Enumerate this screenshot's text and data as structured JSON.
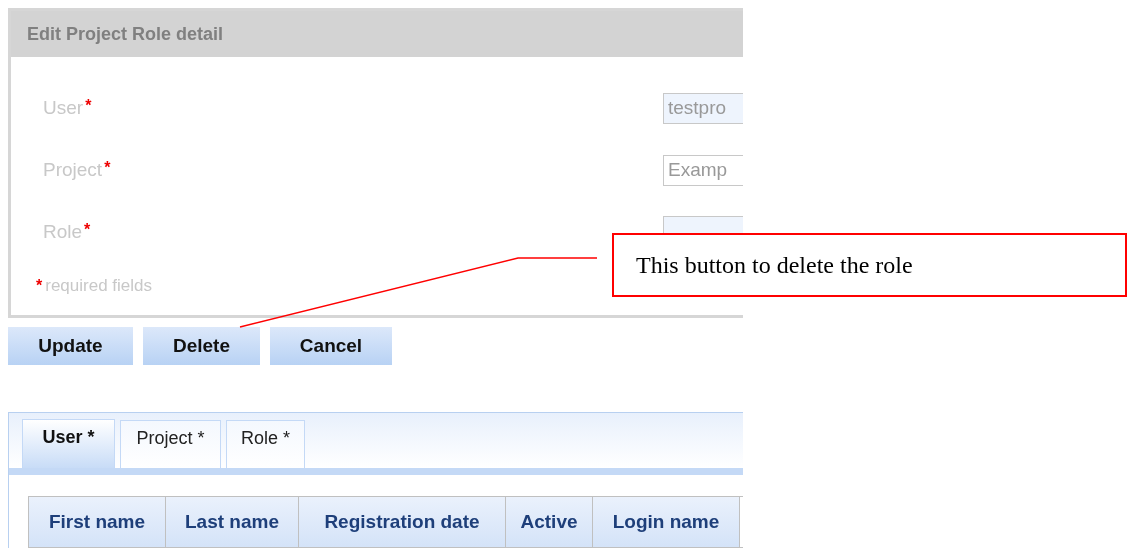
{
  "panel": {
    "title": "Edit Project Role detail",
    "fields": [
      {
        "label": "User",
        "marker": "*",
        "value": "testpro"
      },
      {
        "label": "Project",
        "marker": "*",
        "value": "Examp"
      },
      {
        "label": "Role",
        "marker": "*"
      }
    ],
    "required_note": {
      "marker": "*",
      "text": "required fields"
    }
  },
  "buttons": [
    "Update",
    "Delete",
    "Cancel"
  ],
  "tabs": [
    {
      "label": "User *",
      "selected": true
    },
    {
      "label": "Project *",
      "selected": false
    },
    {
      "label": "Role *",
      "selected": false
    }
  ],
  "table": {
    "columns": [
      "First name",
      "Last name",
      "Registration date",
      "Active",
      "Login name"
    ]
  },
  "callout": {
    "text": "This button to delete the role"
  }
}
